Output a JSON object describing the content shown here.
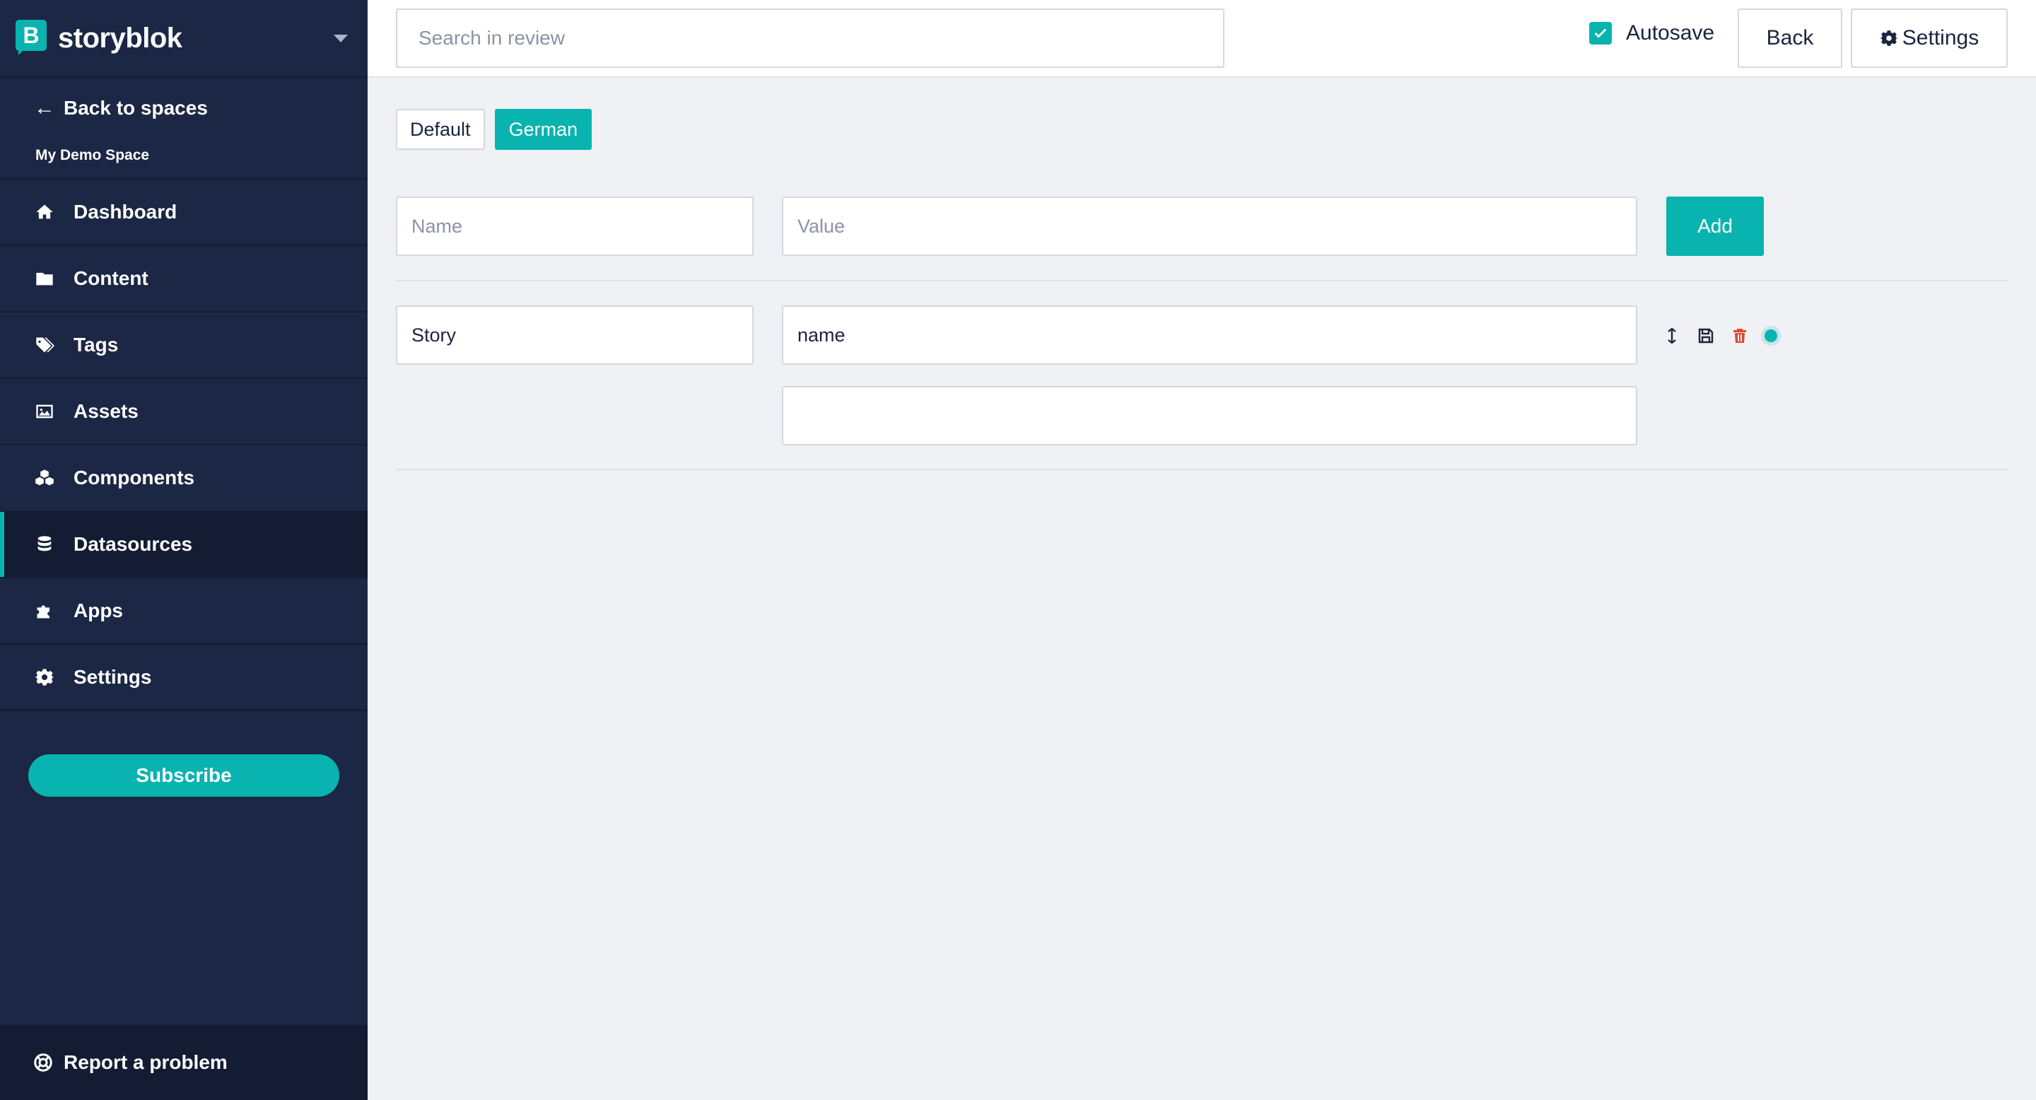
{
  "app": {
    "brand_name": "storyblok",
    "brand_letter": "B",
    "brand_color": "#09b3af"
  },
  "sidebar": {
    "back_label": "Back to spaces",
    "space_name": "My Demo Space",
    "items": [
      {
        "label": "Dashboard",
        "icon": "home-icon",
        "active": false
      },
      {
        "label": "Content",
        "icon": "folder-icon",
        "active": false
      },
      {
        "label": "Tags",
        "icon": "tags-icon",
        "active": false
      },
      {
        "label": "Assets",
        "icon": "image-icon",
        "active": false
      },
      {
        "label": "Components",
        "icon": "cubes-icon",
        "active": false
      },
      {
        "label": "Datasources",
        "icon": "database-icon",
        "active": true
      },
      {
        "label": "Apps",
        "icon": "puzzle-icon",
        "active": false
      },
      {
        "label": "Settings",
        "icon": "gear-icon",
        "active": false
      }
    ],
    "subscribe_label": "Subscribe",
    "report_label": "Report a problem"
  },
  "topbar": {
    "search_placeholder": "Search in review",
    "autosave_label": "Autosave",
    "autosave_checked": true,
    "back_label": "Back",
    "settings_label": "Settings"
  },
  "main": {
    "languages": [
      {
        "label": "Default",
        "active": false
      },
      {
        "label": "German",
        "active": true
      }
    ],
    "new_entry": {
      "name_placeholder": "Name",
      "value_placeholder": "Value",
      "add_label": "Add"
    },
    "entries": [
      {
        "name": "Story",
        "value": "name",
        "dimension_value": ""
      }
    ]
  }
}
